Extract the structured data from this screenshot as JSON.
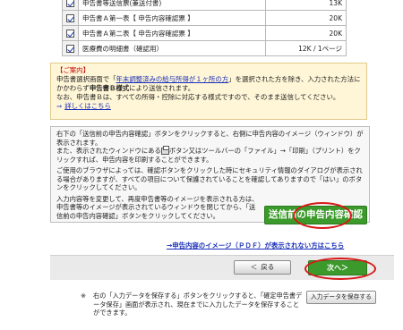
{
  "files": [
    {
      "name": "申告書等送信票(兼送付書)",
      "size": "13K"
    },
    {
      "name": "申告書Ａ第一表【 申告内容確認票 】",
      "size": "20K"
    },
    {
      "name": "申告書Ａ第二表【 申告内容確認票 】",
      "size": "20K"
    },
    {
      "name": "医療費の明細書（確認用）",
      "size": "12K / 1ページ"
    }
  ],
  "notice": {
    "title": "【ご案内】",
    "line1_pre": "申告書選択画面で「",
    "line1_link": "年末調整済みの給与所得が１ヶ所の方",
    "line1_post": "」を選択された方を除き、入力された方法にかかわらず",
    "line2_bold": "申告書Ｂ様式",
    "line2_post": "により送信されます。",
    "line3": "なお、申告書Ｂは、すべての所得・控除に対応する様式ですので、そのまま送信してください。",
    "detail_arrow": "⇒",
    "detail_link": "詳しくはこちら"
  },
  "info": {
    "para1": "右下の「送信前の申告内容確認」ボタンをクリックすると、右側に申告内容のイメージ（ウィンドウ）が表示されます。",
    "para1b_pre": "また、表示されたウィンドウにある",
    "para1b_post": "ボタン又はツールバーの「ファイル」→「印刷」（プリント）をクリックすれば、申告内容を印刷することができます。",
    "para2": "ご使用のブラウザによっては、確認ボタンをクリックした時にセキュリティ情報のダイアログが表示される場合がありますが、すべての項目について保護されていることを確認してありますので「はい」のボタンをクリックしてください。",
    "para3": "入力内容等を変更して、再度申告書等のイメージを表示される方は、申告書等のイメージが表示されているウィンドウを閉じてから、「送信前の申告内容確認」ボタンをクリックしてください。",
    "confirm_button": "送信前の申告内容確認"
  },
  "pdf_link": "→申告内容のイメージ（ＰＤＦ）が表示されない方はこちら",
  "nav": {
    "back_chevron": "＜",
    "back_label": "戻る",
    "next_label": "次へ＞"
  },
  "save": {
    "button": "入力データを保存する",
    "mark": "※",
    "note": "右の「入力データを保存する」ボタンをクリックすると、「確定申告書データ保存」画面が表示され、現在までに入力したデータを保存することができます。"
  }
}
